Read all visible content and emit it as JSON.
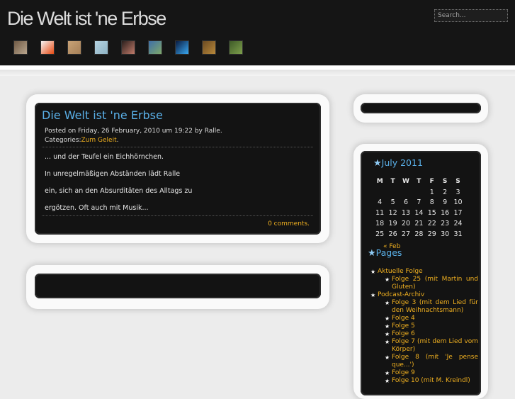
{
  "site": {
    "title": "Die Welt ist 'ne Erbse"
  },
  "search": {
    "placeholder": "Search..."
  },
  "thumbnails": [
    {
      "name": "thumb-1",
      "c1": "#6f5a45",
      "c2": "#b9a58d"
    },
    {
      "name": "thumb-2",
      "c1": "#f4f4f4",
      "c2": "#e84a12"
    },
    {
      "name": "thumb-3",
      "c1": "#c8a276",
      "c2": "#a68058"
    },
    {
      "name": "thumb-4",
      "c1": "#b4d2e0",
      "c2": "#8fb3c4"
    },
    {
      "name": "thumb-5",
      "c1": "#2a1f1c",
      "c2": "#c07a6a"
    },
    {
      "name": "thumb-6",
      "c1": "#3f6fa8",
      "c2": "#7fa86a"
    },
    {
      "name": "thumb-7",
      "c1": "#0a1a40",
      "c2": "#39a8f0"
    },
    {
      "name": "thumb-8",
      "c1": "#6a4a22",
      "c2": "#b8883a"
    },
    {
      "name": "thumb-9",
      "c1": "#3e5a28",
      "c2": "#7ea04c"
    }
  ],
  "post": {
    "title": "Die Welt ist 'ne Erbse",
    "posted_on": "Posted on Friday, 26 February, 2010 um 19:22 by Ralle.",
    "categories_label": "Categories:",
    "category": "Zum Geleit",
    "category_suffix": ".",
    "paragraphs": [
      "... und der Teufel ein Eichhörnchen.",
      "In unregelmäßigen Abständen lädt Ralle",
      "ein, sich an den Absurditäten des Alltags zu",
      "ergötzen. Oft auch mit Musik..."
    ],
    "comments": "0 comments."
  },
  "calendar": {
    "title": "July 2011",
    "weekdays": [
      "M",
      "T",
      "W",
      "T",
      "F",
      "S",
      "S"
    ],
    "weeks": [
      [
        "",
        "",
        "",
        "",
        "1",
        "2",
        "3"
      ],
      [
        "4",
        "5",
        "6",
        "7",
        "8",
        "9",
        "10"
      ],
      [
        "11",
        "12",
        "13",
        "14",
        "15",
        "16",
        "17"
      ],
      [
        "18",
        "19",
        "20",
        "21",
        "22",
        "23",
        "24"
      ],
      [
        "25",
        "26",
        "27",
        "28",
        "29",
        "30",
        "31"
      ]
    ],
    "prev_link": "« Feb"
  },
  "pages": {
    "title": "Pages",
    "items": [
      {
        "label": "Aktuelle Folge",
        "level": 0
      },
      {
        "label": "Folge 25 (mit Martin und Gluten)",
        "level": 1
      },
      {
        "label": "Podcast-Archiv",
        "level": 0
      },
      {
        "label": "Folge 3 (mit dem Lied für den Weihnachtsmann)",
        "level": 1
      },
      {
        "label": "Folge 4",
        "level": 1
      },
      {
        "label": "Folge 5",
        "level": 1
      },
      {
        "label": "Folge 6",
        "level": 1
      },
      {
        "label": "Folge 7 (mit dem Lied vom Körper)",
        "level": 1
      },
      {
        "label": "Folge 8 (mit 'Je pense que...')",
        "level": 1
      },
      {
        "label": "Folge 9",
        "level": 1
      },
      {
        "label": "Folge 10 (mit M. Kreindl)",
        "level": 1
      }
    ]
  },
  "colors": {
    "header_bg": "#151515",
    "link": "#5ab0e8",
    "accent": "#f0b020",
    "page_bg": "#ececec",
    "panel_bg": "#131313"
  }
}
